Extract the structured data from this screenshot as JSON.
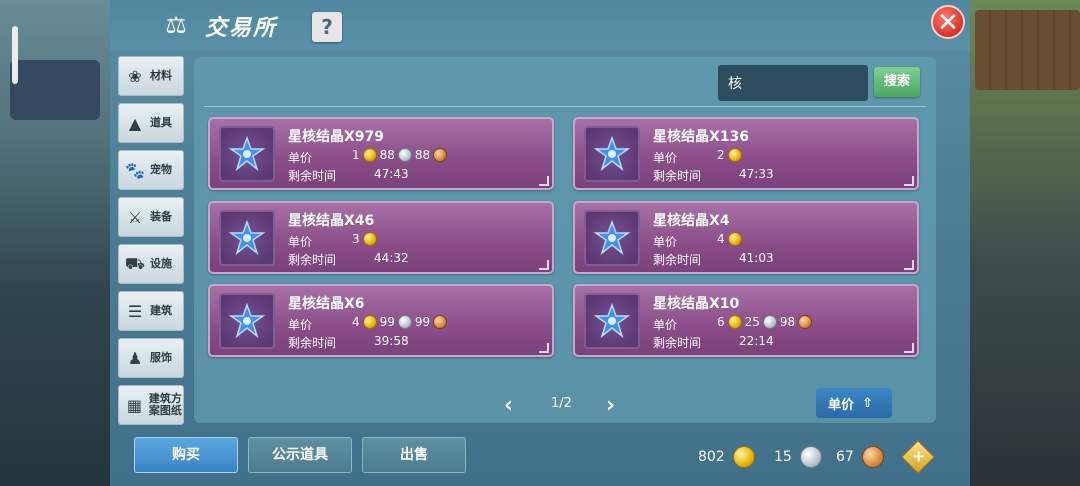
{
  "window": {
    "title": "交易所",
    "help_label": "?",
    "close_label": "✕"
  },
  "sidebar": {
    "items": [
      {
        "label": "材料",
        "icon": "materials-icon",
        "glyph": "❀"
      },
      {
        "label": "道具",
        "icon": "item-icon",
        "glyph": "▲"
      },
      {
        "label": "宠物",
        "icon": "pet-paw-icon",
        "glyph": "🐾"
      },
      {
        "label": "装备",
        "icon": "equipment-sword-icon",
        "glyph": "⚔"
      },
      {
        "label": "设施",
        "icon": "facility-icon",
        "glyph": "⛟"
      },
      {
        "label": "建筑",
        "icon": "building-icon",
        "glyph": "☰"
      },
      {
        "label": "服饰",
        "icon": "clothing-icon",
        "glyph": "♟"
      },
      {
        "label": "建筑方案图纸",
        "icon": "blueprint-icon",
        "glyph": "▦"
      }
    ]
  },
  "search": {
    "value": "核",
    "button_label": "搜索"
  },
  "listings": [
    {
      "name": "星核结晶X979",
      "price_label": "单价",
      "gold": "1",
      "silver": "88",
      "copper": "88",
      "time_label": "剩余时间",
      "time": "47:43"
    },
    {
      "name": "星核结晶X136",
      "price_label": "单价",
      "gold": "2",
      "silver": "",
      "copper": "",
      "time_label": "剩余时间",
      "time": "47:33"
    },
    {
      "name": "星核结晶X46",
      "price_label": "单价",
      "gold": "3",
      "silver": "",
      "copper": "",
      "time_label": "剩余时间",
      "time": "44:32"
    },
    {
      "name": "星核结晶X4",
      "price_label": "单价",
      "gold": "4",
      "silver": "",
      "copper": "",
      "time_label": "剩余时间",
      "time": "41:03"
    },
    {
      "name": "星核结晶X6",
      "price_label": "单价",
      "gold": "4",
      "silver": "99",
      "copper": "99",
      "time_label": "剩余时间",
      "time": "39:58"
    },
    {
      "name": "星核结晶X10",
      "price_label": "单价",
      "gold": "6",
      "silver": "25",
      "copper": "98",
      "time_label": "剩余时间",
      "time": "22:14"
    }
  ],
  "pager": {
    "prev": "‹",
    "page": "1/2",
    "next": "›"
  },
  "sort": {
    "label": "单价",
    "arrow": "⇧"
  },
  "bottom": {
    "buy_label": "购买",
    "public_label": "公示道具",
    "sell_label": "出售",
    "gold_amount": "802",
    "silver_amount": "15",
    "copper_amount": "67",
    "add_label": "+"
  },
  "colors": {
    "card_bg": "#8a4d89",
    "panel_bg": "#5f97ad",
    "buy_button": "#3a83c4",
    "search_button": "#4aa862",
    "close_button": "#d8312a"
  }
}
